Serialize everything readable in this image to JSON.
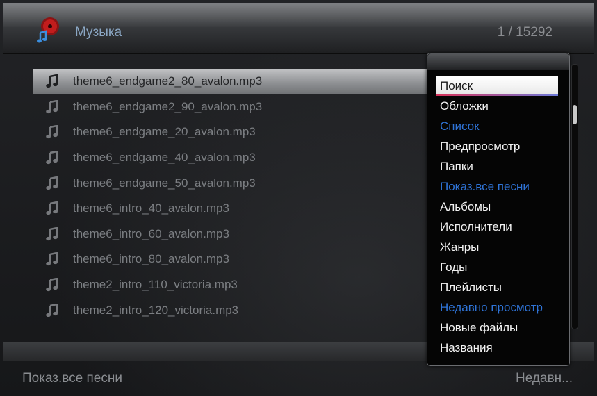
{
  "header": {
    "title": "Музыка",
    "counter": "1 / 15292",
    "icon": "music-disc-icon"
  },
  "files": [
    {
      "name": "theme6_endgame2_80_avalon.mp3",
      "selected": true
    },
    {
      "name": "theme6_endgame2_90_avalon.mp3"
    },
    {
      "name": "theme6_endgame_20_avalon.mp3"
    },
    {
      "name": "theme6_endgame_40_avalon.mp3"
    },
    {
      "name": "theme6_endgame_50_avalon.mp3"
    },
    {
      "name": "theme6_intro_40_avalon.mp3"
    },
    {
      "name": "theme6_intro_60_avalon.mp3"
    },
    {
      "name": "theme6_intro_80_avalon.mp3"
    },
    {
      "name": "theme2_intro_110_victoria.mp3"
    },
    {
      "name": "theme2_intro_120_victoria.mp3"
    }
  ],
  "menu": {
    "items": [
      {
        "label": "Поиск",
        "style": "highlight"
      },
      {
        "label": "Обложки",
        "style": "normal"
      },
      {
        "label": "Список",
        "style": "blue"
      },
      {
        "label": "Предпросмотр",
        "style": "normal"
      },
      {
        "label": "Папки",
        "style": "normal"
      },
      {
        "label": "Показ.все песни",
        "style": "blue"
      },
      {
        "label": "Альбомы",
        "style": "normal"
      },
      {
        "label": "Исполнители",
        "style": "normal"
      },
      {
        "label": "Жанры",
        "style": "normal"
      },
      {
        "label": "Годы",
        "style": "normal"
      },
      {
        "label": "Плейлисты",
        "style": "normal"
      },
      {
        "label": "Недавно просмотр",
        "style": "blue"
      },
      {
        "label": "Новые файлы",
        "style": "normal"
      },
      {
        "label": "Названия",
        "style": "normal"
      }
    ]
  },
  "footer": {
    "left": "Показ.все песни",
    "right": "Недавн..."
  },
  "colors": {
    "accent_blue": "#2f74d8",
    "title_blue": "#8ba7c4",
    "text_dim": "#7b7e82"
  }
}
